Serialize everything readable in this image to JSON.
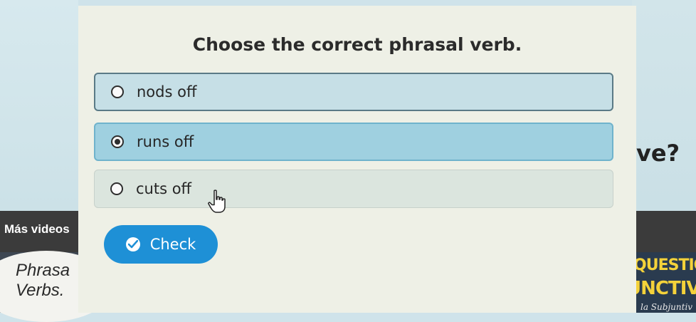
{
  "quiz": {
    "title": "Choose the correct phrasal verb.",
    "options": [
      {
        "label": "nods off",
        "selected": false
      },
      {
        "label": "runs off",
        "selected": true
      },
      {
        "label": "cuts off",
        "selected": false
      }
    ],
    "check_label": "Check"
  },
  "background": {
    "more_videos_label": "Más videos",
    "behind_word": "ove?",
    "left_thumb_text_line1": "Phrasa",
    "left_thumb_text_line2": "Verbs.",
    "right_thumb_top": "QUESTION",
    "right_thumb_mid": "UNCTIVE",
    "right_thumb_bottom": "la Subjuntiv"
  },
  "colors": {
    "accent": "#1e90d6",
    "selected_option": "#9fd0e0",
    "card": "#eef0e6",
    "thumb_text": "#f4d23a"
  },
  "icons": [
    "radio-unselected-icon",
    "radio-selected-icon",
    "checkmark-circle-icon",
    "hand-pointer-icon"
  ]
}
